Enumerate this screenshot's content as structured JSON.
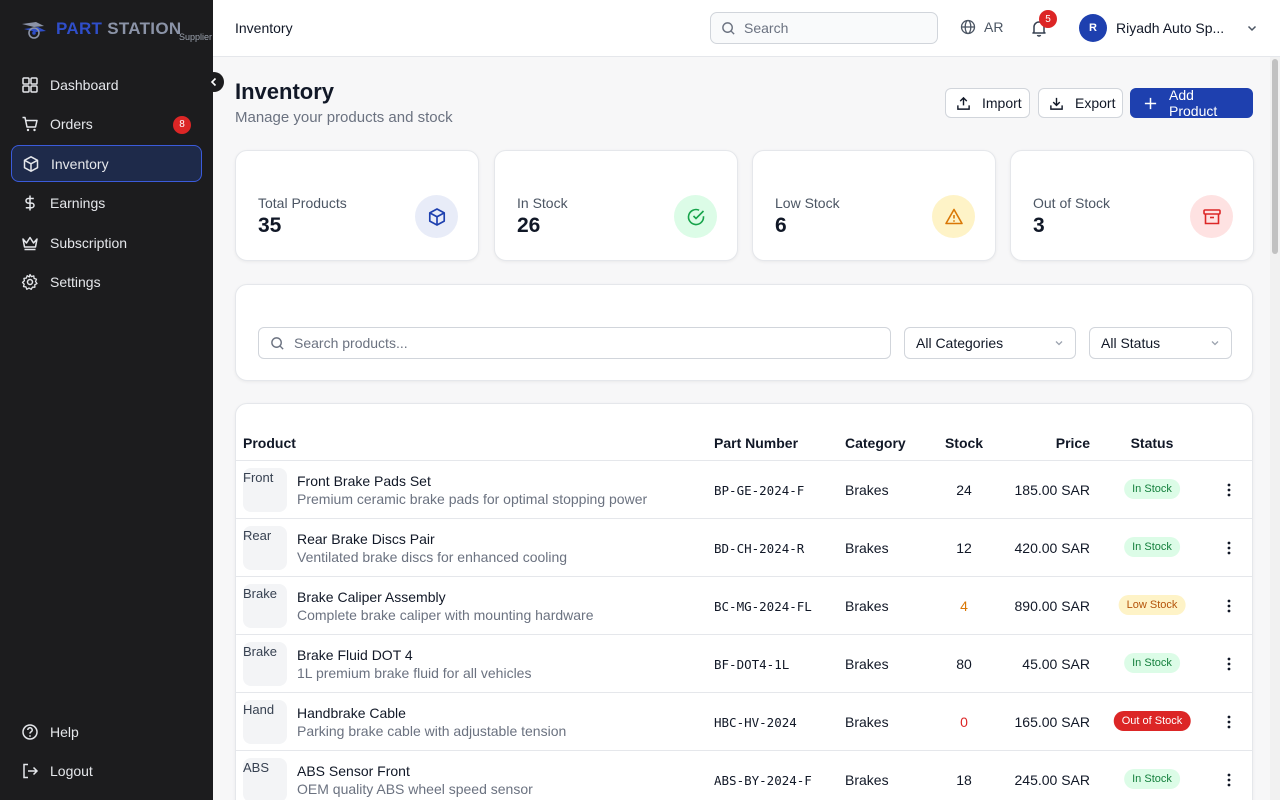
{
  "brand": {
    "name_a": "PART",
    "name_b": " STATION",
    "sub": "Supplier"
  },
  "sidebar": {
    "items": [
      {
        "label": "Dashboard",
        "icon": "dashboard-icon"
      },
      {
        "label": "Orders",
        "icon": "cart-icon",
        "badge": "8"
      },
      {
        "label": "Inventory",
        "icon": "box-icon",
        "active": true
      },
      {
        "label": "Earnings",
        "icon": "dollar-icon"
      },
      {
        "label": "Subscription",
        "icon": "crown-icon"
      },
      {
        "label": "Settings",
        "icon": "gear-icon"
      }
    ],
    "bottom": [
      {
        "label": "Help",
        "icon": "help-icon"
      },
      {
        "label": "Logout",
        "icon": "logout-icon"
      }
    ]
  },
  "header": {
    "title": "Inventory",
    "search_placeholder": "Search",
    "lang": "AR",
    "notifications": "5",
    "user_initial": "R",
    "user_name": "Riyadh Auto Sp..."
  },
  "page": {
    "title": "Inventory",
    "subtitle": "Manage your products and stock",
    "import_label": "Import",
    "export_label": "Export",
    "add_label": "Add Product"
  },
  "stats": [
    {
      "label": "Total Products",
      "value": "35",
      "icon": "box-icon",
      "bg": "#e8ecf8",
      "fg": "#1e40af"
    },
    {
      "label": "In Stock",
      "value": "26",
      "icon": "check-circle-icon",
      "bg": "#dcfce7",
      "fg": "#16a34a"
    },
    {
      "label": "Low Stock",
      "value": "6",
      "icon": "warning-icon",
      "bg": "#fef3c7",
      "fg": "#d97706"
    },
    {
      "label": "Out of Stock",
      "value": "3",
      "icon": "archive-icon",
      "bg": "#fee2e2",
      "fg": "#dc2626"
    }
  ],
  "filters": {
    "search_placeholder": "Search products...",
    "category": "All Categories",
    "status": "All Status"
  },
  "table": {
    "headers": {
      "product": "Product",
      "part": "Part Number",
      "category": "Category",
      "stock": "Stock",
      "price": "Price",
      "status": "Status"
    },
    "rows": [
      {
        "thumb": "Front",
        "name": "Front Brake Pads Set",
        "desc": "Premium ceramic brake pads for optimal stopping power",
        "part": "BP-GE-2024-F",
        "category": "Brakes",
        "stock": "24",
        "price": "185.00 SAR",
        "status": "In Stock",
        "kind": "in"
      },
      {
        "thumb": "Rear",
        "name": "Rear Brake Discs Pair",
        "desc": "Ventilated brake discs for enhanced cooling",
        "part": "BD-CH-2024-R",
        "category": "Brakes",
        "stock": "12",
        "price": "420.00 SAR",
        "status": "In Stock",
        "kind": "in"
      },
      {
        "thumb": "Brake",
        "name": "Brake Caliper Assembly",
        "desc": "Complete brake caliper with mounting hardware",
        "part": "BC-MG-2024-FL",
        "category": "Brakes",
        "stock": "4",
        "price": "890.00 SAR",
        "status": "Low Stock",
        "kind": "low"
      },
      {
        "thumb": "Brake",
        "name": "Brake Fluid DOT 4",
        "desc": "1L premium brake fluid for all vehicles",
        "part": "BF-DOT4-1L",
        "category": "Brakes",
        "stock": "80",
        "price": "45.00 SAR",
        "status": "In Stock",
        "kind": "in"
      },
      {
        "thumb": "Hand",
        "name": "Handbrake Cable",
        "desc": "Parking brake cable with adjustable tension",
        "part": "HBC-HV-2024",
        "category": "Brakes",
        "stock": "0",
        "price": "165.00 SAR",
        "status": "Out of Stock",
        "kind": "out"
      },
      {
        "thumb": "ABS",
        "name": "ABS Sensor Front",
        "desc": "OEM quality ABS wheel speed sensor",
        "part": "ABS-BY-2024-F",
        "category": "Brakes",
        "stock": "18",
        "price": "245.00 SAR",
        "status": "In Stock",
        "kind": "in"
      }
    ]
  },
  "colors": {
    "accent": "#1e40af",
    "in_bg": "#dcfce7",
    "in_fg": "#15803d",
    "low_bg": "#fef3c7",
    "low_fg": "#b45309",
    "out_bg": "#dc2626",
    "out_fg": "#ffffff",
    "stock_low": "#d97706",
    "stock_out": "#dc2626"
  }
}
